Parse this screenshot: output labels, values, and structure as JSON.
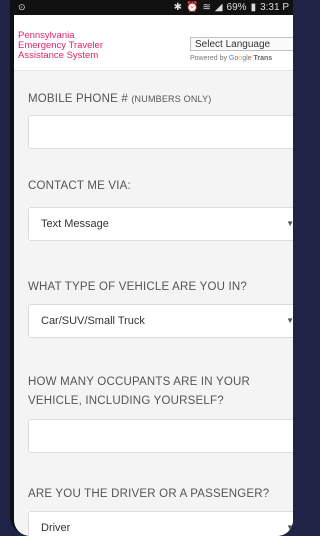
{
  "status_bar": {
    "left_icon": "notification-icon",
    "battery": "69%",
    "time": "3:31 P"
  },
  "header": {
    "brand_lines": [
      "Pennsylvania",
      "Emergency Traveler",
      "Assistance System"
    ],
    "language_select": "Select Language",
    "powered_by": "Powered by",
    "google": [
      "G",
      "o",
      "o",
      "g",
      "l",
      "e"
    ],
    "translate": "Trans"
  },
  "form": {
    "phone_label": "MOBILE PHONE #",
    "phone_hint": "(NUMBERS ONLY)",
    "phone_value": "",
    "contact_label": "CONTACT ME VIA:",
    "contact_value": "Text Message",
    "vehicle_label": "WHAT TYPE OF VEHICLE ARE YOU IN?",
    "vehicle_value": "Car/SUV/Small Truck",
    "occupants_label_1": "HOW MANY OCCUPANTS ARE IN YOUR",
    "occupants_label_2": "VEHICLE, INCLUDING YOURSELF?",
    "occupants_value": "",
    "role_label": "ARE YOU THE DRIVER OR A PASSENGER?",
    "role_value": "Driver"
  },
  "colors": {
    "brand": "#e0246c",
    "background": "#1f2447"
  }
}
